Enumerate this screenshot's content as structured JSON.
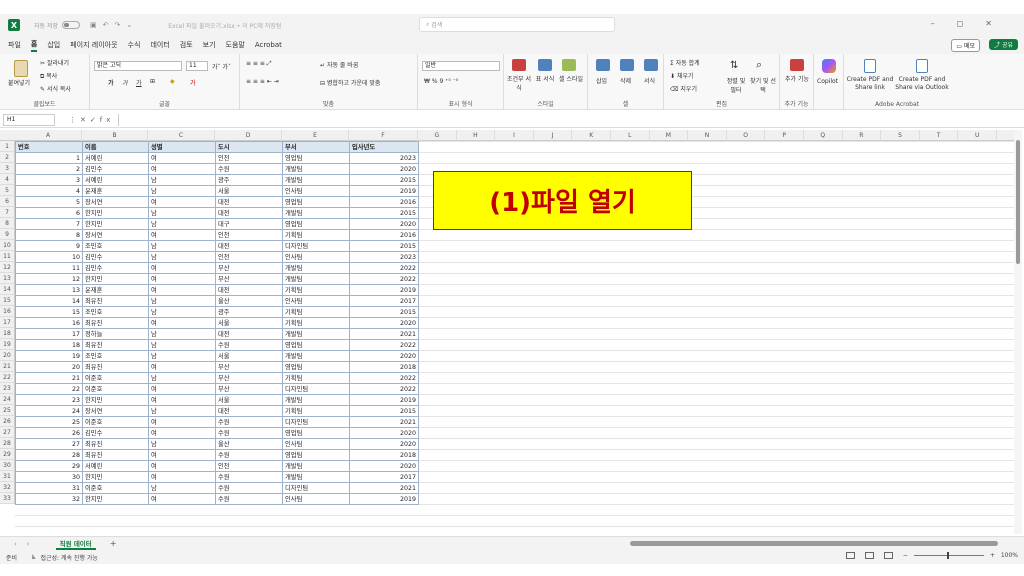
{
  "titlebar": {
    "autosave_label": "자동 저장",
    "filename": "Excel 파일 불러오기.xlsx • 이 PC에 저장됨",
    "search_placeholder": "검색"
  },
  "menu": {
    "items": [
      "파일",
      "홈",
      "삽입",
      "페이지 레이아웃",
      "수식",
      "데이터",
      "검토",
      "보기",
      "도움말",
      "Acrobat"
    ],
    "active": "홈",
    "memo_label": "메모",
    "share_label": "공유"
  },
  "ribbon": {
    "clipboard": {
      "paste": "붙여넣기",
      "cut": "잘라내기",
      "copy": "복사",
      "format_painter": "서식 복사",
      "label": "클립보드"
    },
    "font": {
      "name": "맑은 고딕",
      "size": "11",
      "label": "글꼴"
    },
    "alignment": {
      "wrap": "자동 줄 바꿈",
      "merge": "병합하고 가운데 맞춤",
      "label": "맞춤"
    },
    "number": {
      "format": "일반",
      "label": "표시 형식"
    },
    "styles": {
      "conditional": "조건부 서식",
      "table": "표 서식",
      "cell": "셀 스타일",
      "label": "스타일"
    },
    "cells": {
      "insert": "삽입",
      "delete": "삭제",
      "format": "서식",
      "label": "셀"
    },
    "editing": {
      "autosum": "자동 합계",
      "fill": "채우기",
      "clear": "지우기",
      "sort": "정렬 및 필터",
      "find": "찾기 및 선택",
      "label": "편집"
    },
    "addins": {
      "addin": "추가 기능",
      "label": "추가 기능"
    },
    "copilot": {
      "label": "Copilot"
    },
    "acrobat": {
      "create_pdf": "Create PDF and Share link",
      "create_outlook": "Create PDF and Share via Outlook",
      "label": "Adobe Acrobat"
    }
  },
  "formulabar": {
    "namebox": "H1"
  },
  "columns": [
    "A",
    "B",
    "C",
    "D",
    "E",
    "F",
    "G",
    "H",
    "I",
    "J",
    "K",
    "L",
    "M",
    "N",
    "O",
    "P",
    "Q",
    "R",
    "S",
    "T",
    "U"
  ],
  "headers": [
    "번호",
    "이름",
    "성별",
    "도시",
    "부서",
    "입사년도"
  ],
  "rows": [
    [
      1,
      "서예린",
      "여",
      "인천",
      "영업팀",
      2023
    ],
    [
      2,
      "김민수",
      "여",
      "수원",
      "개발팀",
      2020
    ],
    [
      3,
      "서예린",
      "남",
      "광주",
      "개발팀",
      2015
    ],
    [
      4,
      "윤재훈",
      "남",
      "서울",
      "인사팀",
      2019
    ],
    [
      5,
      "장서연",
      "여",
      "대전",
      "영업팀",
      2016
    ],
    [
      6,
      "한지민",
      "남",
      "대전",
      "개발팀",
      2015
    ],
    [
      7,
      "한지민",
      "남",
      "대구",
      "영업팀",
      2020
    ],
    [
      8,
      "장서연",
      "여",
      "인천",
      "기획팀",
      2016
    ],
    [
      9,
      "조민호",
      "남",
      "대전",
      "디자인팀",
      2015
    ],
    [
      10,
      "김민수",
      "남",
      "인천",
      "인사팀",
      2023
    ],
    [
      11,
      "김민수",
      "여",
      "부산",
      "개발팀",
      2022
    ],
    [
      12,
      "한지민",
      "여",
      "부산",
      "개발팀",
      2022
    ],
    [
      13,
      "윤재훈",
      "여",
      "대전",
      "기획팀",
      2019
    ],
    [
      14,
      "최유진",
      "남",
      "울산",
      "인사팀",
      2017
    ],
    [
      15,
      "조민호",
      "남",
      "광주",
      "기획팀",
      2015
    ],
    [
      16,
      "최유진",
      "여",
      "서울",
      "기획팀",
      2020
    ],
    [
      17,
      "정하늘",
      "남",
      "대전",
      "개발팀",
      2021
    ],
    [
      18,
      "최유진",
      "남",
      "수원",
      "영업팀",
      2022
    ],
    [
      19,
      "조민호",
      "남",
      "서울",
      "개발팀",
      2020
    ],
    [
      20,
      "최유진",
      "여",
      "부산",
      "영업팀",
      2018
    ],
    [
      21,
      "이준호",
      "남",
      "부산",
      "기획팀",
      2022
    ],
    [
      22,
      "이준호",
      "여",
      "부산",
      "디자인팀",
      2022
    ],
    [
      23,
      "한지민",
      "여",
      "서울",
      "개발팀",
      2019
    ],
    [
      24,
      "장서연",
      "남",
      "대전",
      "기획팀",
      2015
    ],
    [
      25,
      "이준호",
      "여",
      "수원",
      "디자인팀",
      2021
    ],
    [
      26,
      "김민수",
      "여",
      "수원",
      "영업팀",
      2020
    ],
    [
      27,
      "최유진",
      "남",
      "울산",
      "인사팀",
      2020
    ],
    [
      28,
      "최유진",
      "여",
      "수원",
      "영업팀",
      2018
    ],
    [
      29,
      "서예린",
      "여",
      "인천",
      "개발팀",
      2020
    ],
    [
      30,
      "한지민",
      "여",
      "수원",
      "개발팀",
      2017
    ],
    [
      31,
      "이준호",
      "남",
      "수원",
      "디자인팀",
      2021
    ],
    [
      32,
      "한지민",
      "여",
      "수원",
      "인사팀",
      2019
    ]
  ],
  "callout": "(1)파일 열기",
  "sheet_tab": "직원 데이터",
  "status": {
    "ready": "준비",
    "accessibility": "접근성: 계속 진행 가능",
    "zoom": "100%"
  }
}
